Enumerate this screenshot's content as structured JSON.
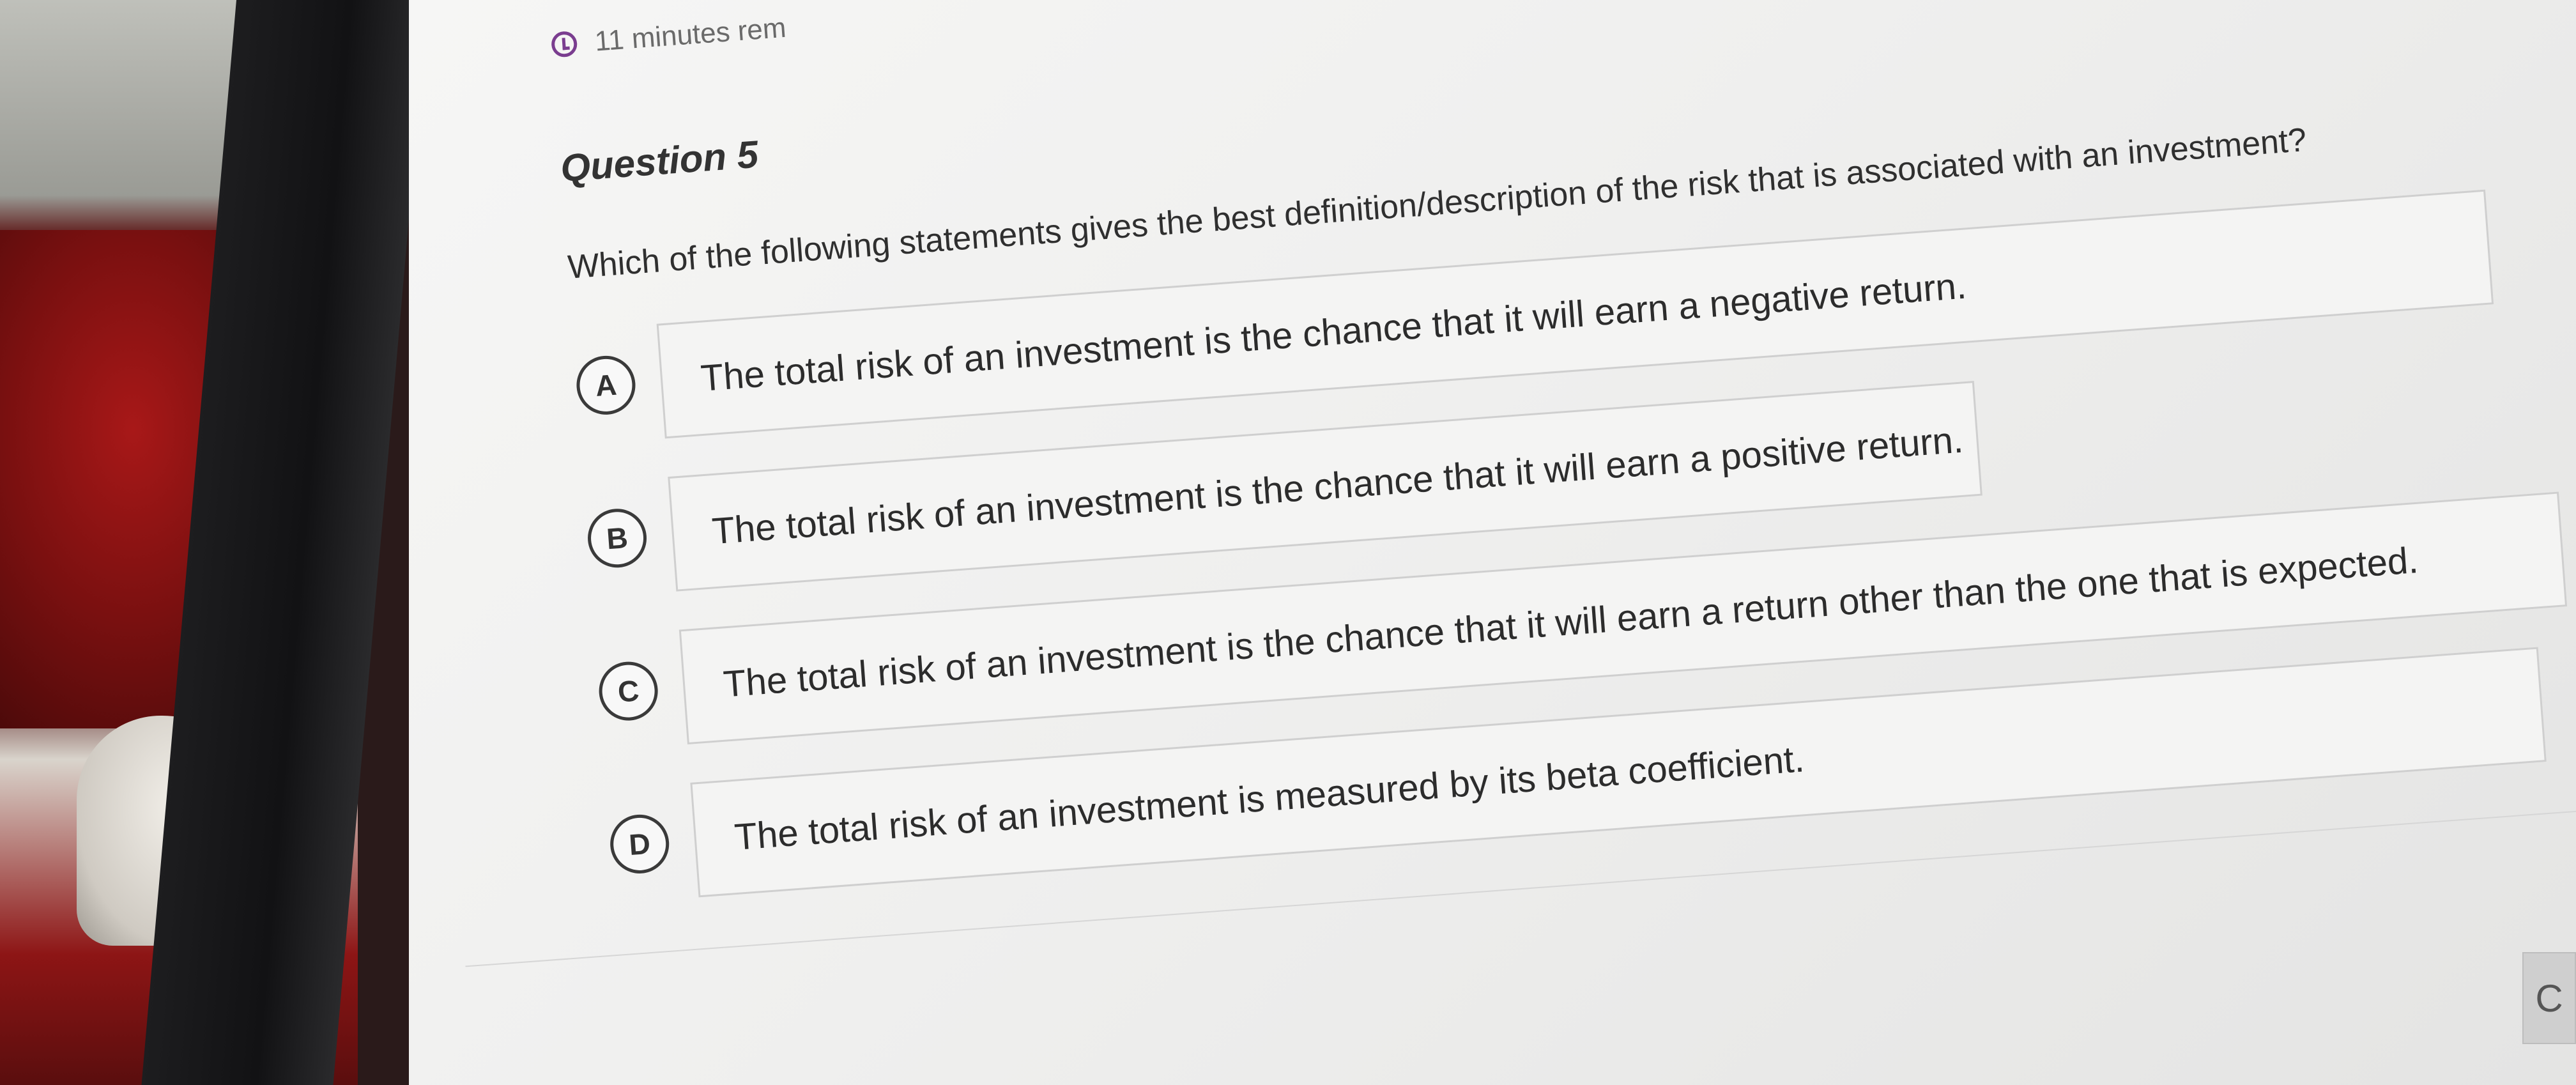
{
  "timer": {
    "icon": "clock-icon",
    "text": "11 minutes rem"
  },
  "question": {
    "title": "Question 5",
    "prompt": "Which of the following statements gives the best definition/description of the risk that is associated with an investment?"
  },
  "options": [
    {
      "letter": "A",
      "text": "The total risk of an investment is the chance that it will earn a negative return."
    },
    {
      "letter": "B",
      "text": "The total risk of an investment is the chance that it will earn a positive return."
    },
    {
      "letter": "C",
      "text": "The total risk of an investment is the chance that it will earn a return other than the one that is expected."
    },
    {
      "letter": "D",
      "text": "The total risk of an investment is measured by its beta coefficient."
    }
  ],
  "next_button": {
    "label": "C"
  }
}
